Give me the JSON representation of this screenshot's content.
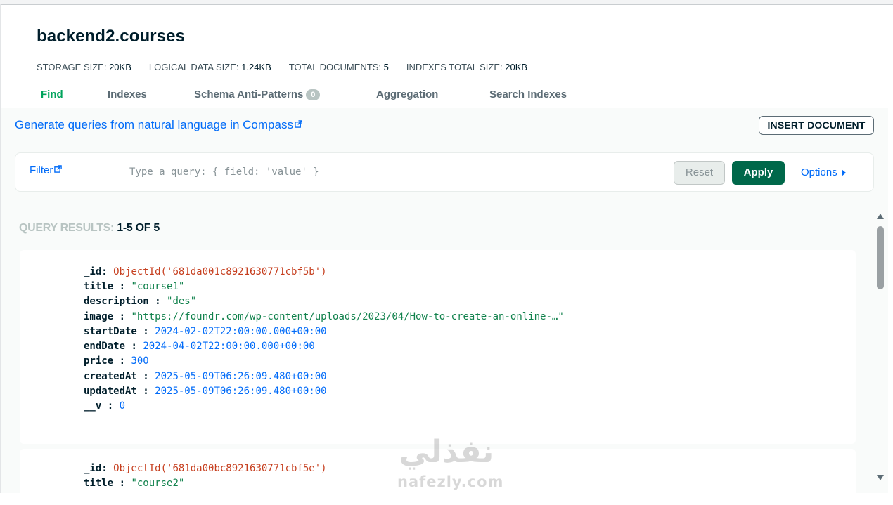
{
  "collection": {
    "title": "backend2.courses"
  },
  "stats": [
    {
      "label": "STORAGE SIZE: ",
      "value": "20KB"
    },
    {
      "label": "LOGICAL DATA SIZE: ",
      "value": "1.24KB"
    },
    {
      "label": "TOTAL DOCUMENTS: ",
      "value": "5"
    },
    {
      "label": "INDEXES TOTAL SIZE: ",
      "value": "20KB"
    }
  ],
  "tabs": {
    "find": "Find",
    "indexes": "Indexes",
    "schema": "Schema Anti-Patterns",
    "schema_badge": "0",
    "aggregation": "Aggregation",
    "search_indexes": "Search Indexes",
    "active": "find"
  },
  "toolbar": {
    "nl_link": "Generate queries from natural language in Compass",
    "insert_button": "INSERT DOCUMENT"
  },
  "filter": {
    "label": "Filter",
    "placeholder": "Type a query: { field: 'value' }",
    "reset_label": "Reset",
    "apply_label": "Apply",
    "options_label": "Options"
  },
  "results": {
    "label": "QUERY RESULTS: ",
    "count": "1-5 OF 5"
  },
  "documents": [
    {
      "fields": [
        {
          "key": "_id",
          "value": "ObjectId('681da001c8921630771cbf5b')"
        },
        {
          "key": "title",
          "value": "\"course1\""
        },
        {
          "key": "description",
          "value": "\"des\""
        },
        {
          "key": "image",
          "value": "\"https://foundr.com/wp-content/uploads/2023/04/How-to-create-an-online-…\""
        },
        {
          "key": "startDate",
          "value": "2024-02-02T22:00:00.000+00:00"
        },
        {
          "key": "endDate",
          "value": "2024-04-02T22:00:00.000+00:00"
        },
        {
          "key": "price",
          "value": "300"
        },
        {
          "key": "createdAt",
          "value": "2025-05-09T06:26:09.480+00:00"
        },
        {
          "key": "updatedAt",
          "value": "2025-05-09T06:26:09.480+00:00"
        },
        {
          "key": "__v",
          "value": "0"
        }
      ]
    },
    {
      "fields": [
        {
          "key": "_id",
          "value": "ObjectId('681da00bc8921630771cbf5e')"
        },
        {
          "key": "title",
          "value": "\"course2\""
        }
      ]
    }
  ],
  "watermark": {
    "arabic": "نفذلي",
    "latin": "nafezly.com"
  },
  "colors": {
    "accent_green": "#00a35c",
    "apply_green": "#00684a",
    "link_blue": "#016bf8",
    "objectid_red": "#c63f1f",
    "string_green": "#12824d",
    "number_blue": "#016bf8"
  }
}
